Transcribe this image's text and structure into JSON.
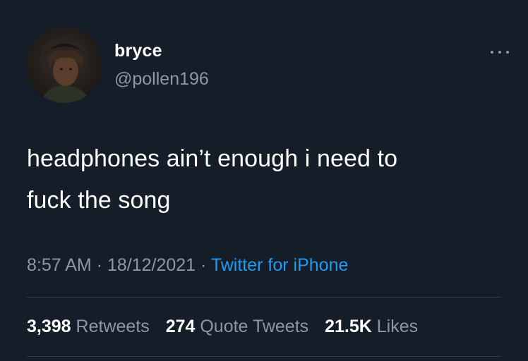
{
  "user": {
    "display_name": "bryce",
    "handle": "@pollen196"
  },
  "tweet": {
    "text_line1": "headphones ain’t enough i need to",
    "text_line2": "fuck the song"
  },
  "meta": {
    "time": "8:57 AM",
    "separator": " · ",
    "date": "18/12/2021",
    "source": "Twitter for iPhone"
  },
  "stats": {
    "retweets_count": "3,398",
    "retweets_label": "Retweets",
    "quotes_count": "274",
    "quotes_label": "Quote Tweets",
    "likes_count": "21.5K",
    "likes_label": "Likes"
  },
  "icons": {
    "more": "more-horizontal-icon"
  },
  "colors": {
    "background": "#151d28",
    "secondary_text": "#8b98a5",
    "link": "#1d9bf0"
  }
}
